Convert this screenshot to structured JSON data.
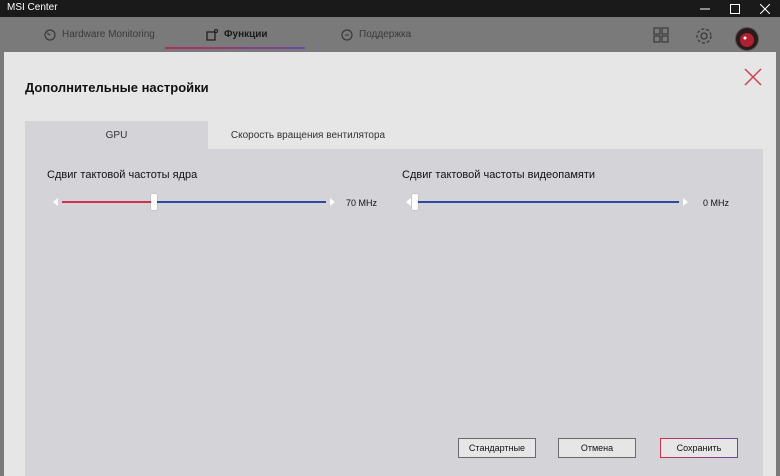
{
  "window": {
    "title": "MSI Center"
  },
  "nav": {
    "tabs": [
      {
        "label": "Hardware Monitoring",
        "active": false
      },
      {
        "label": "Функции",
        "active": true
      },
      {
        "label": "Поддержка",
        "active": false
      }
    ]
  },
  "modal": {
    "title": "Дополнительные настройки",
    "tabs": [
      {
        "label": "GPU",
        "active": true
      },
      {
        "label": "Скорость вращения вентилятора",
        "active": false
      }
    ],
    "core_clock": {
      "label": "Сдвиг тактовой частоты ядра",
      "value_text": "70 MHz",
      "position": 0.35
    },
    "mem_clock": {
      "label": "Сдвиг тактовой частоты видеопамяти",
      "value_text": "0 MHz",
      "position": 0.0
    },
    "buttons": {
      "default_label": "Стандартные",
      "cancel_label": "Отмена",
      "save_label": "Сохранить"
    }
  },
  "colors": {
    "accent_red": "#d0304a",
    "accent_blue": "#2d4aa0",
    "titlebar": "#1a1a1a",
    "close_x": "#d04050"
  }
}
